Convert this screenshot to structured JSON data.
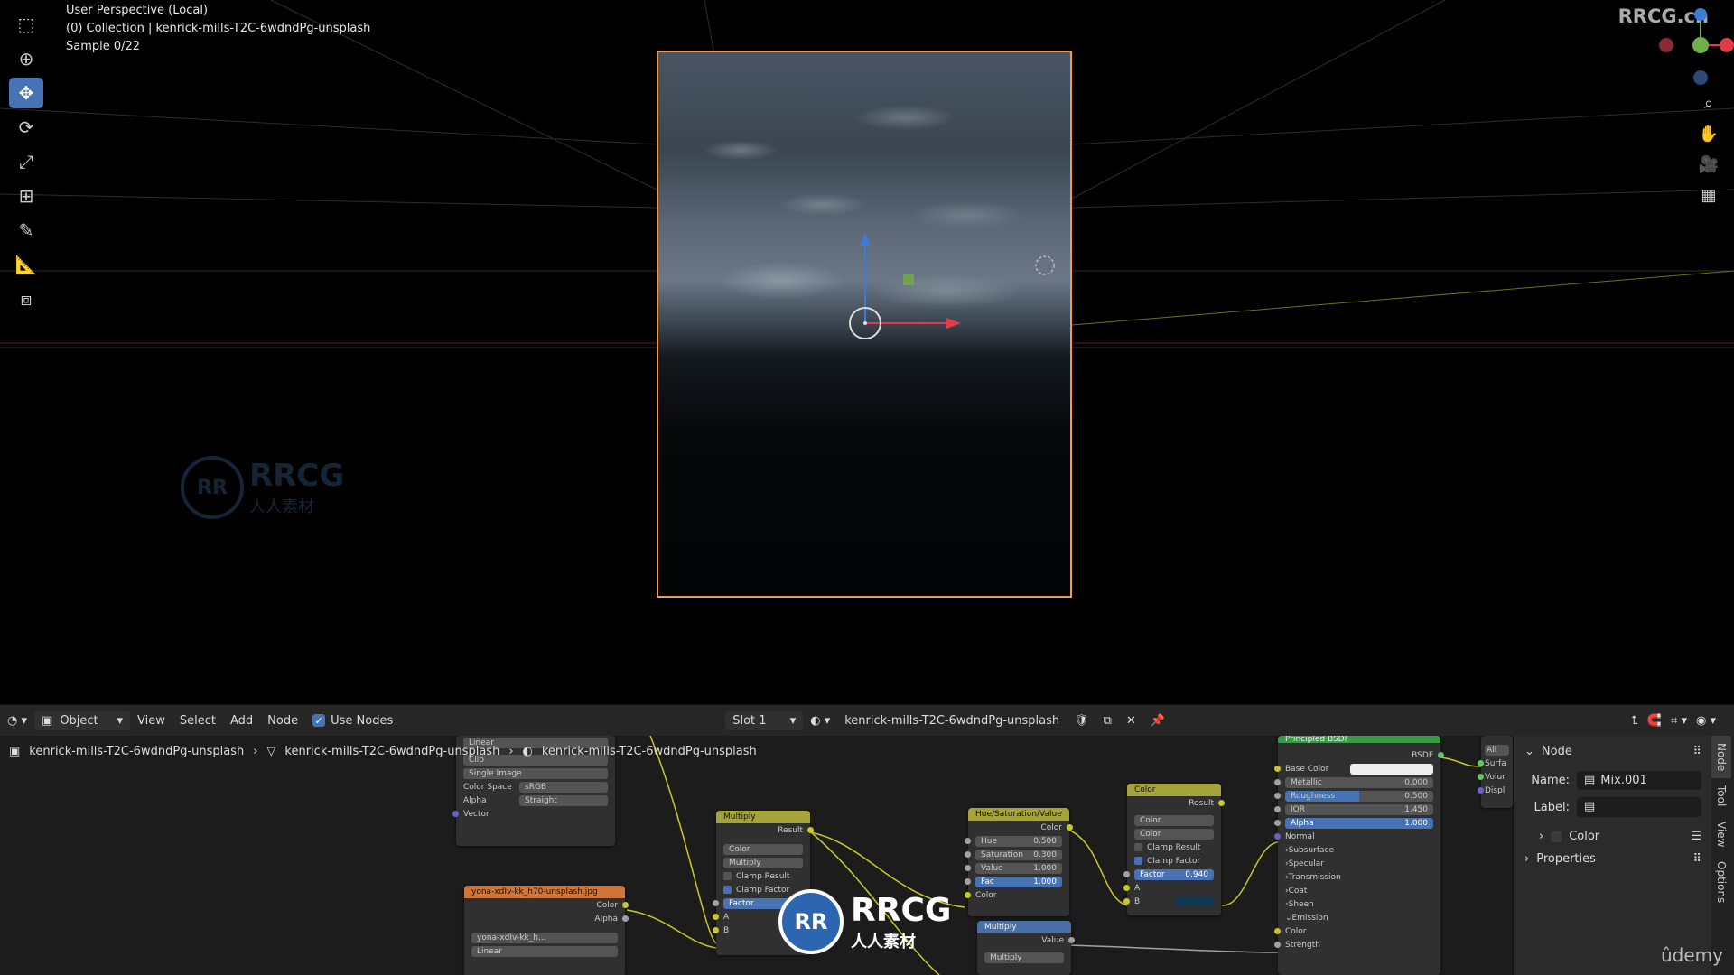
{
  "viewport": {
    "perspective": "User Perspective (Local)",
    "collection": "(0) Collection | kenrick-mills-T2C-6wdndPg-unsplash",
    "sample": "Sample 0/22",
    "tools": [
      "select-box",
      "cursor",
      "move",
      "rotate",
      "scale",
      "transform",
      "annotate",
      "measure",
      "add-cube"
    ],
    "active_tool": "move"
  },
  "watermark_top": "RRCG.cn",
  "header": {
    "mode": "Object",
    "menu": [
      "View",
      "Select",
      "Add",
      "Node"
    ],
    "use_nodes": "Use Nodes",
    "slot": "Slot 1",
    "material": "kenrick-mills-T2C-6wdndPg-unsplash"
  },
  "breadcrumb": [
    "kenrick-mills-T2C-6wdndPg-unsplash",
    "kenrick-mills-T2C-6wdndPg-unsplash",
    "kenrick-mills-T2C-6wdndPg-unsplash"
  ],
  "nodes": {
    "image_top": {
      "interp": "Linear",
      "ext": "Clip",
      "source": "Single Image",
      "cs_label": "Color Space",
      "cs_value": "sRGB",
      "alpha_label": "Alpha",
      "alpha_value": "Straight",
      "vector": "Vector"
    },
    "image2": {
      "title": "yona-xdIv-kk_h70-unsplash.jpg",
      "color": "Color",
      "alpha": "Alpha",
      "file": "yona-xdIv-kk_h...",
      "interp": "Linear"
    },
    "multiply1": {
      "title": "Multiply",
      "result": "Result",
      "type": "Color",
      "mode": "Multiply",
      "clamp_result": "Clamp Result",
      "clamp_factor": "Clamp Factor",
      "factor": "Factor",
      "a": "A",
      "b": "B"
    },
    "hsv": {
      "title": "Hue/Saturation/Value",
      "color_out": "Color",
      "hue": "Hue",
      "hue_v": "0.500",
      "sat": "Saturation",
      "sat_v": "0.300",
      "val": "Value",
      "val_v": "1.000",
      "fac": "Fac",
      "fac_v": "1.000",
      "color_in": "Color"
    },
    "multiply2": {
      "title": "Multiply",
      "value": "Value",
      "mode": "Multiply"
    },
    "color_mix": {
      "title": "Color",
      "result": "Result",
      "type": "Color",
      "mode": "Color",
      "clamp_result": "Clamp Result",
      "clamp_factor": "Clamp Factor",
      "factor": "Factor",
      "factor_v": "0.940",
      "a": "A",
      "b": "B"
    },
    "bsdf": {
      "title": "Principled BSDF",
      "out": "BSDF",
      "base": "Base Color",
      "metallic": "Metallic",
      "metallic_v": "0.000",
      "rough": "Roughness",
      "rough_v": "0.500",
      "ior": "IOR",
      "ior_v": "1.450",
      "alpha": "Alpha",
      "alpha_v": "1.000",
      "normal": "Normal",
      "subs": "Subsurface",
      "spec": "Specular",
      "trans": "Transmission",
      "coat": "Coat",
      "sheen": "Sheen",
      "emission": "Emission",
      "color": "Color",
      "strength": "Strength"
    },
    "output": {
      "all": "All",
      "surf": "Surfa",
      "vol": "Volur",
      "disp": "Displ"
    }
  },
  "side_panel": {
    "section": "Node",
    "name_label": "Name:",
    "name_value": "Mix.001",
    "label_label": "Label:",
    "label_value": "",
    "color": "Color",
    "properties": "Properties",
    "tabs": [
      "Node",
      "Tool",
      "View",
      "Options"
    ]
  },
  "watermark": {
    "brand": "RRCG",
    "sub": "人人素材"
  },
  "udemy": "ûdemy",
  "colors": {
    "accent": "#4772b3",
    "selection": "#f39b52",
    "color_socket": "#c7c729"
  }
}
